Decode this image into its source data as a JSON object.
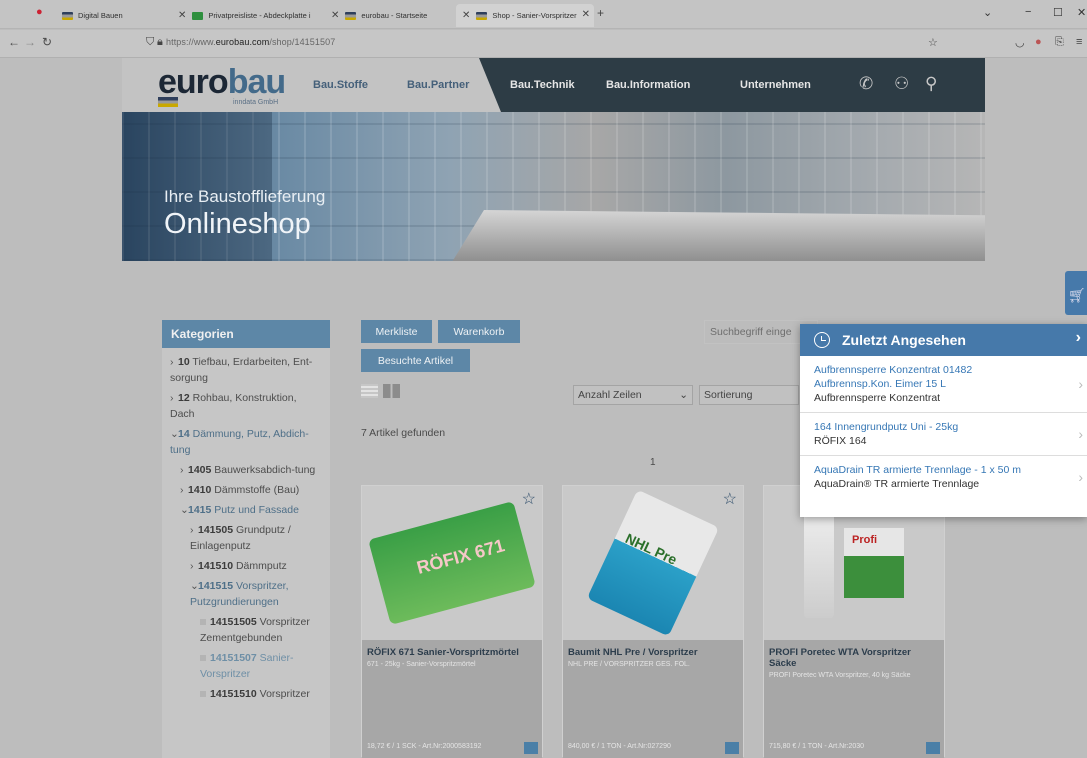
{
  "browser": {
    "tabs": [
      {
        "label": "Digital Bauen",
        "icon": "eurobau-favicon"
      },
      {
        "label": "Privatpreisliste - Abdeckplatte i",
        "icon": "green-favicon"
      },
      {
        "label": "eurobau - Startseite",
        "icon": "eurobau-favicon"
      },
      {
        "label": "Shop - Sanier-Vorspritzer",
        "icon": "eurobau-favicon"
      }
    ],
    "url_prefix": "https://www.",
    "url_domain": "eurobau.com",
    "url_path": "/shop/14151507"
  },
  "site": {
    "logo_main": "euro",
    "logo_accent": "bau",
    "logo_sub": "inndata GmbH",
    "nav": [
      "Bau.Stoffe",
      "Bau.Partner",
      "Bau.Technik",
      "Bau.Information",
      "Unternehmen"
    ]
  },
  "hero": {
    "subtitle": "Ihre Baustofflieferung",
    "title": "Onlineshop"
  },
  "sidebar": {
    "title": "Kategorien",
    "items": [
      {
        "num": "10",
        "label": "Tiefbau, Erdarbeiten, Ent-sorgung"
      },
      {
        "num": "12",
        "label": "Rohbau, Konstruktion, Dach"
      },
      {
        "num": "14",
        "label": "Dämmung, Putz, Abdich-tung"
      },
      {
        "num": "1405",
        "label": "Bauwerksabdich-tung"
      },
      {
        "num": "1410",
        "label": "Dämmstoffe (Bau)"
      },
      {
        "num": "1415",
        "label": "Putz und Fassade"
      },
      {
        "num": "141505",
        "label": "Grundputz / Einlagenputz"
      },
      {
        "num": "141510",
        "label": "Dämmputz"
      },
      {
        "num": "141515",
        "label": "Vorspritzer, Putzgrundierungen"
      },
      {
        "num": "14151505",
        "label": "Vorspritzer Zementgebunden"
      },
      {
        "num": "14151507",
        "label": "Sanier-Vorspritzer"
      },
      {
        "num": "14151510",
        "label": "Vorspritzer"
      }
    ]
  },
  "toolbar": {
    "merkliste": "Merkliste",
    "warenkorb": "Warenkorb",
    "besuchte": "Besuchte Artikel",
    "search_placeholder": "Suchbegriff einge",
    "rows_label": "Anzahl Zeilen",
    "sort_label": "Sortierung",
    "found": "7 Artikel gefunden",
    "page": "1"
  },
  "products": [
    {
      "name": "RÖFIX 671 Sanier-Vorspritzmörtel",
      "desc": "671 - 25kg - Sanier-Vorspritzmörtel",
      "price": "18,72 € / 1 SCK - Art.Nr:2000583192",
      "bag_text": "RÖFIX 671"
    },
    {
      "name": "Baumit NHL Pre / Vorspritzer",
      "desc": "NHL PRE / VORSPRITZER GES. FOL.",
      "price": "840,00 € / 1 TON - Art.Nr:027290",
      "bag_text": "NHL Pre"
    },
    {
      "name": "PROFI Poretec WTA Vorspritzer Säcke",
      "desc": "PROFI Poretec WTA Vorspritzer, 40 kg Säcke",
      "price": "715,80 € / 1 TON - Art.Nr:2030",
      "bag_text": "Profi"
    }
  ],
  "recently_viewed": {
    "title": "Zuletzt Angesehen",
    "items": [
      {
        "links": [
          "Aufbrennsperre Konzentrat 01482",
          "Aufbrennsp.Kon. Eimer 15 L"
        ],
        "text": "Aufbrennsperre Konzentrat"
      },
      {
        "links": [
          "164 Innengrundputz Uni - 25kg"
        ],
        "text": "RÖFIX 164"
      },
      {
        "links": [
          "AquaDrain TR armierte Trennlage - 1 x 50 m"
        ],
        "text": "AquaDrain® TR armierte Trennlage"
      }
    ]
  },
  "colors": {
    "accent": "#4679aa",
    "dark_nav": "#2d3c45",
    "link": "#3677b5"
  }
}
